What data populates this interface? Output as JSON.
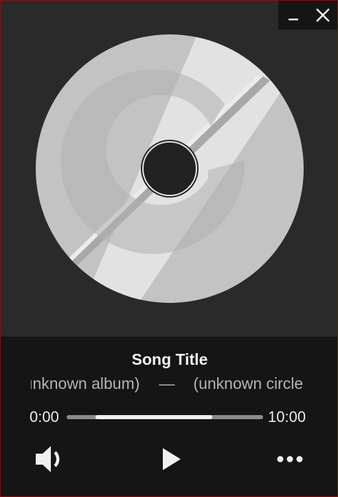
{
  "window": {
    "controls": {
      "minimize_icon": "minimize-icon",
      "close_icon": "close-icon"
    }
  },
  "album_art": {
    "icon": "disc-placeholder-icon"
  },
  "track": {
    "title": "Song Title",
    "album": "(unknown album)",
    "separator": "—",
    "artist": "(unknown circle)"
  },
  "playback": {
    "current_time": "0:00",
    "duration": "10:00",
    "progress_percent": 74
  },
  "controls": {
    "volume_icon": "volume-icon",
    "play_icon": "play-icon",
    "more_icon": "more-options-icon"
  },
  "colors": {
    "window_border": "#8a1010",
    "panel_bg": "#151515",
    "art_bg": "#2a2a2a",
    "progress_fill": "#f0f0f0",
    "progress_track": "#8a8a8a"
  }
}
